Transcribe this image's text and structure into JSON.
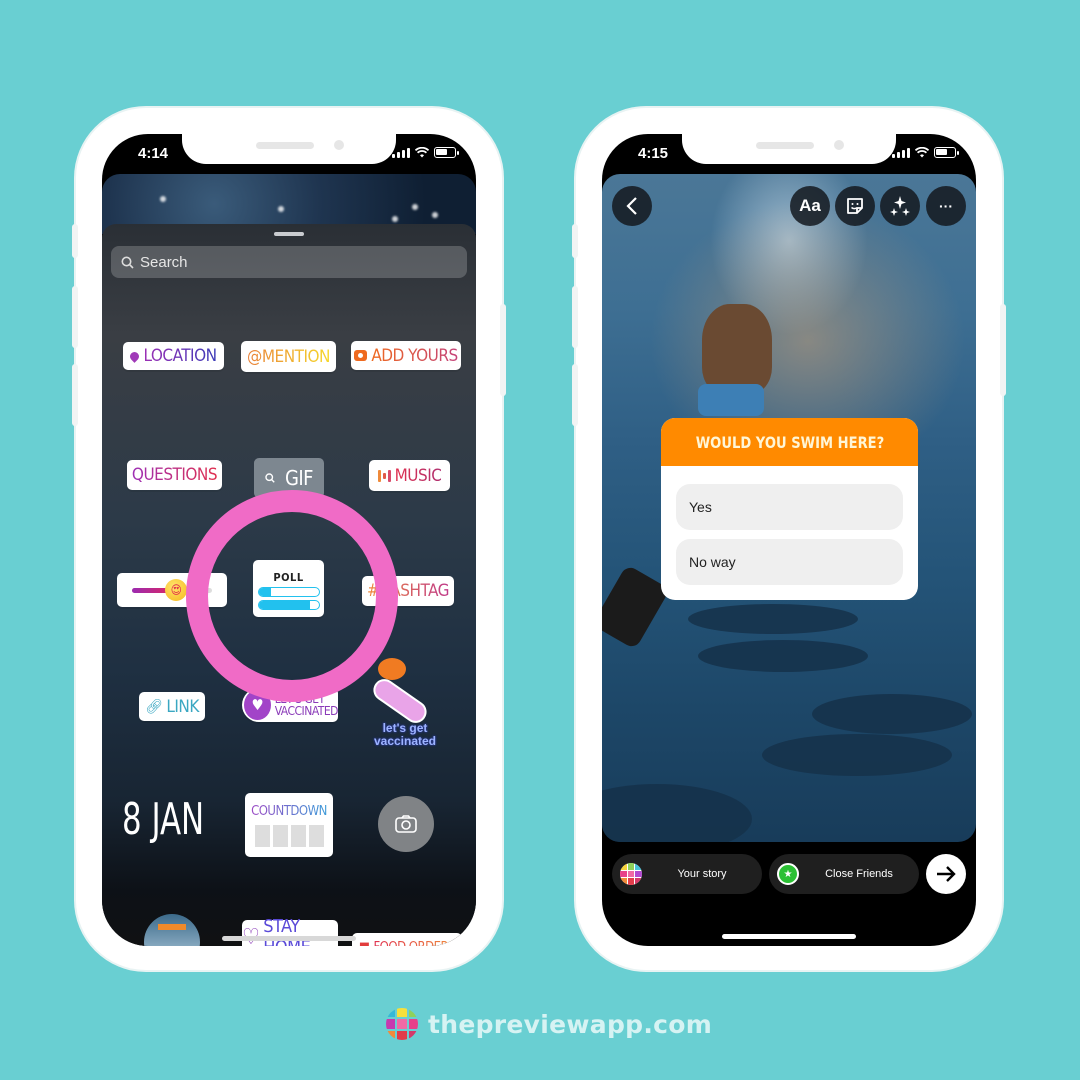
{
  "colors": {
    "background": "#69cfd2",
    "poll_header": "#ff8a00",
    "highlight_ring": "#f06bc6",
    "poll_bar": "#22c1ee"
  },
  "left_phone": {
    "status_time": "4:14",
    "search": {
      "placeholder": "Search",
      "icon": "search-icon"
    },
    "stickers": {
      "location": "LOCATION",
      "mention": "@MENTION",
      "add_yours": "ADD YOURS",
      "questions": "QUESTIONS",
      "gif": "GIF",
      "music": "MUSIC",
      "emoji_slider": {
        "emoji": "😍",
        "value": 0.55
      },
      "poll": {
        "title": "POLL",
        "option_fills": [
          0.2,
          0.85
        ]
      },
      "hashtag": "#HASHTAG",
      "link": "LINK",
      "vaccinated_badge": {
        "line1": "LET'S GET",
        "line2": "VACCINATED"
      },
      "vaccinated_art": {
        "line1": "let's get",
        "line2": "vaccinated"
      },
      "date": "8 JAN",
      "countdown": "COUNTDOWN",
      "stay_home": "STAY HOME",
      "food_orders": "FOOD ORDERS"
    }
  },
  "right_phone": {
    "status_time": "4:15",
    "toolbar": {
      "back": "back-icon",
      "text_label": "Aa",
      "sticker": "sticker-icon",
      "effects": "sparkles-icon",
      "more": "···"
    },
    "poll": {
      "question": "WOULD YOU SWIM HERE?",
      "options": [
        "Yes",
        "No way"
      ]
    },
    "share": {
      "your_story": "Your story",
      "close_friends": "Close Friends",
      "next_icon": "arrow-right-icon"
    }
  },
  "brand": {
    "text": "thepreviewapp.com"
  }
}
